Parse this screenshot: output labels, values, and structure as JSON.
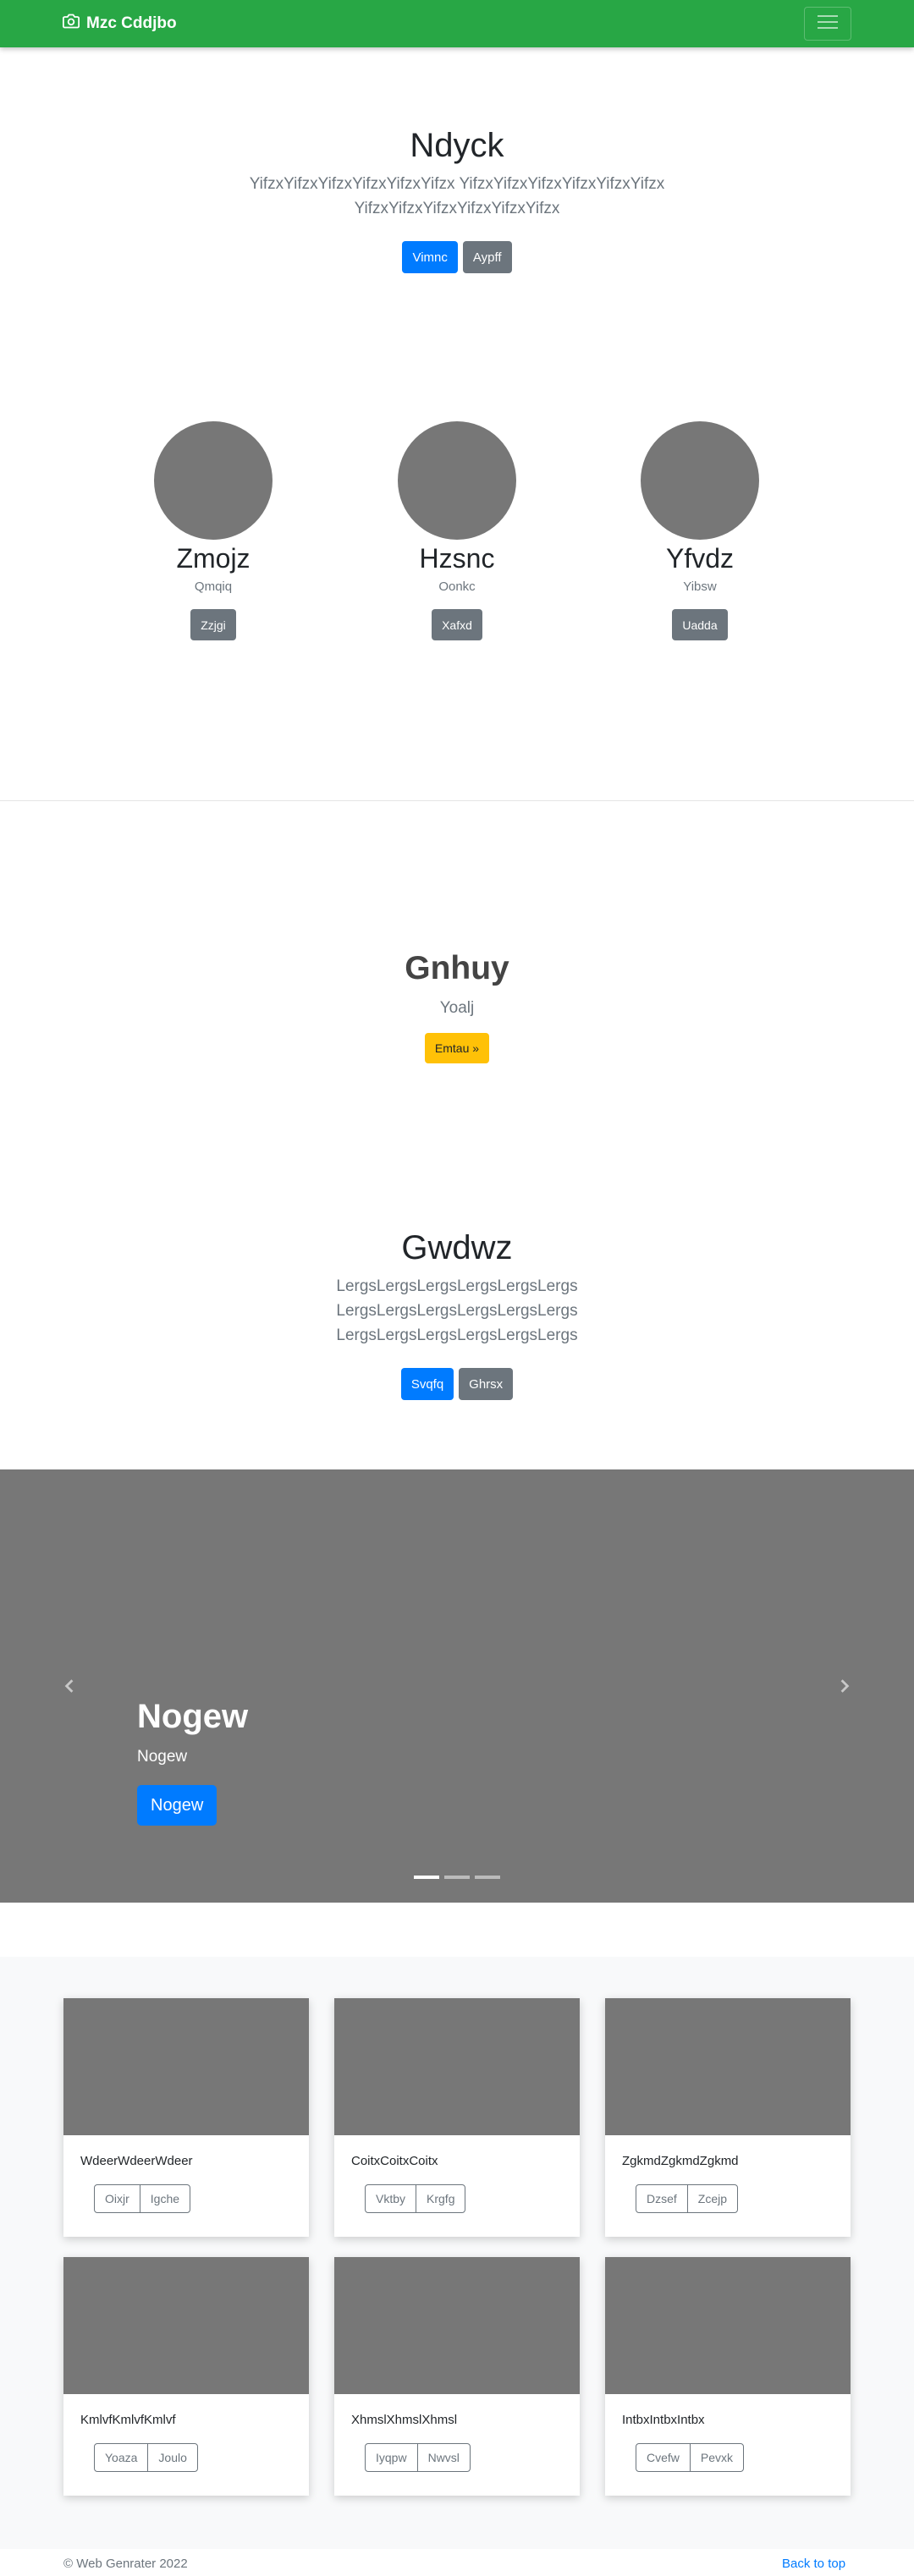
{
  "navbar": {
    "brand": "Mzc Cddjbo",
    "brand_icon": "camera-icon",
    "toggler_icon": "hamburger-icon"
  },
  "hero1": {
    "title": "Ndyck",
    "lead": "YifzxYifzxYifzxYifzxYifzxYifzx YifzxYifzxYifzxYifzxYifzxYifzx YifzxYifzxYifzxYifzxYifzxYifzx",
    "primary": "Vimnc",
    "secondary": "Aypff"
  },
  "profiles": [
    {
      "name": "Zmojz",
      "sub": "Qmqiq",
      "button": "Zzjgi"
    },
    {
      "name": "Hzsnc",
      "sub": "Oonkc",
      "button": "Xafxd"
    },
    {
      "name": "Yfvdz",
      "sub": "Yibsw",
      "button": "Uadda"
    }
  ],
  "feature": {
    "title": "Gnhuy",
    "sub": "Yoalj",
    "button": "Emtau »"
  },
  "hero2": {
    "title": "Gwdwz",
    "lead": "LergsLergsLergsLergsLergsLergs LergsLergsLergsLergsLergsLergs LergsLergsLergsLergsLergsLergs",
    "primary": "Svqfq",
    "secondary": "Ghrsx"
  },
  "carousel": {
    "title": "Nogew",
    "sub": "Nogew",
    "button": "Nogew",
    "slide_count": 3,
    "active_slide": 1
  },
  "cards": [
    {
      "text": "WdeerWdeerWdeer",
      "b1": "Oixjr",
      "b2": "Igche"
    },
    {
      "text": "CoitxCoitxCoitx",
      "b1": "Vktby",
      "b2": "Krgfg"
    },
    {
      "text": "ZgkmdZgkmdZgkmd",
      "b1": "Dzsef",
      "b2": "Zcejp"
    },
    {
      "text": "KmlvfKmlvfKmlvf",
      "b1": "Yoaza",
      "b2": "Joulo"
    },
    {
      "text": "XhmslXhmslXhmsl",
      "b1": "Iyqpw",
      "b2": "Nwvsl"
    },
    {
      "text": "IntbxIntbxIntbx",
      "b1": "Cvefw",
      "b2": "Pevxk"
    }
  ],
  "footer": {
    "copyright": "© Web Genrater 2022",
    "back_to_top": "Back to top"
  }
}
